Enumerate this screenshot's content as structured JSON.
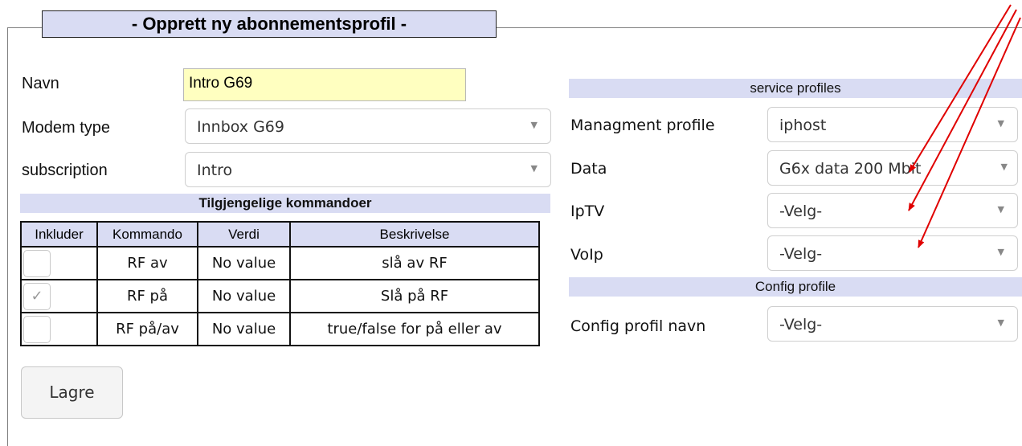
{
  "form": {
    "title": "- Opprett ny abonnementsprofil -",
    "name_label": "Navn",
    "name_value": "Intro G69",
    "modem_label": "Modem type",
    "modem_value": "Innbox G69",
    "subscription_label": "subscription",
    "subscription_value": "Intro"
  },
  "commands": {
    "title": "Tilgjengelige kommandoer",
    "headers": [
      "Inkluder",
      "Kommando",
      "Verdi",
      "Beskrivelse"
    ],
    "rows": [
      {
        "checked": false,
        "command": "RF av",
        "value": "No value",
        "description": "slå av RF"
      },
      {
        "checked": true,
        "command": "RF på",
        "value": "No value",
        "description": "Slå på RF"
      },
      {
        "checked": false,
        "command": "RF på/av",
        "value": "No value",
        "description": "true/false for på eller av"
      }
    ]
  },
  "service_profiles": {
    "title": "service profiles",
    "managment_label": "Managment profile",
    "managment_value": "iphost",
    "data_label": "Data",
    "data_value": "G6x data 200 Mbit",
    "iptv_label": "IpTV",
    "iptv_value": "-Velg-",
    "voip_label": "VoIp",
    "voip_value": "-Velg-"
  },
  "config_profile": {
    "title": "Config profile",
    "name_label": "Config profil navn",
    "name_value": "-Velg-"
  },
  "save_label": "Lagre",
  "icons": {
    "dropdown": "chevron-down-icon",
    "check": "checkmark-icon"
  },
  "colors": {
    "header_bg": "#d9dcf3",
    "input_highlight": "#ffffc0",
    "annotation": "#e00000"
  }
}
